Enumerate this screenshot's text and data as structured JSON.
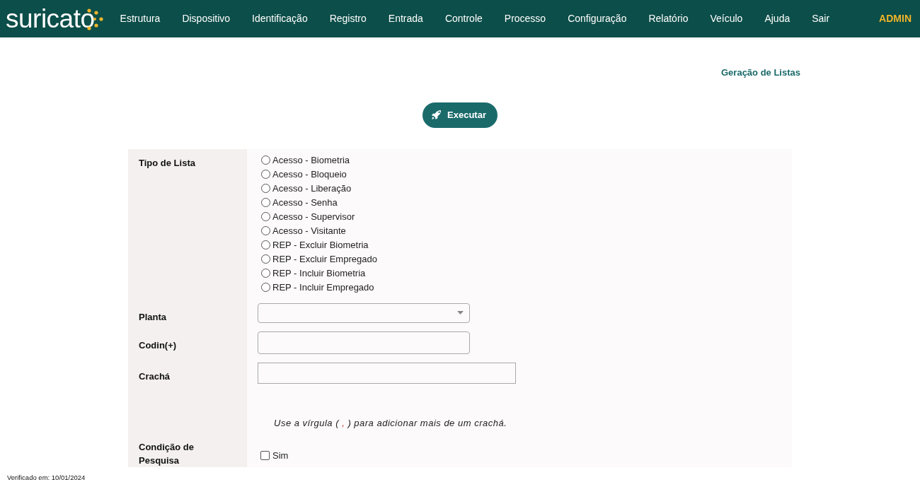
{
  "brand": "suricato",
  "nav": [
    "Estrutura",
    "Dispositivo",
    "Identificação",
    "Registro",
    "Entrada",
    "Controle",
    "Processo",
    "Configuração",
    "Relatório",
    "Veículo",
    "Ajuda",
    "Sair"
  ],
  "user": "ADMIN",
  "page_title": "Geração de Listas",
  "run_button": "Executar",
  "form": {
    "tipo_label": "Tipo de Lista",
    "options": [
      {
        "label": "Acesso - Biometria",
        "selected": false
      },
      {
        "label": "Acesso - Bloqueio",
        "selected": false
      },
      {
        "label": "Acesso - Liberação",
        "selected": false
      },
      {
        "label": "Acesso - Senha",
        "selected": false
      },
      {
        "label": "Acesso - Supervisor",
        "selected": false
      },
      {
        "label": "Acesso - Visitante",
        "selected": false
      },
      {
        "label": "REP - Excluir Biometria",
        "selected": false
      },
      {
        "label": "REP - Excluir Empregado",
        "selected": false
      },
      {
        "label": "REP - Incluir Biometria",
        "selected": false
      },
      {
        "label": "REP - Incluir Empregado",
        "selected": false
      }
    ],
    "planta_label": "Planta",
    "codin_label": "Codin(+)",
    "cracha_label": "Crachá",
    "hint": {
      "before": "Use a vírgula ( ",
      "mark": ",",
      "after": " ) para adicionar mais de um crachá."
    },
    "condicao_label": "Condição de Pesquisa",
    "condicao_option": {
      "label": "Sim",
      "checked": false
    }
  },
  "footer": "Verificado em: 10/01/2024"
}
